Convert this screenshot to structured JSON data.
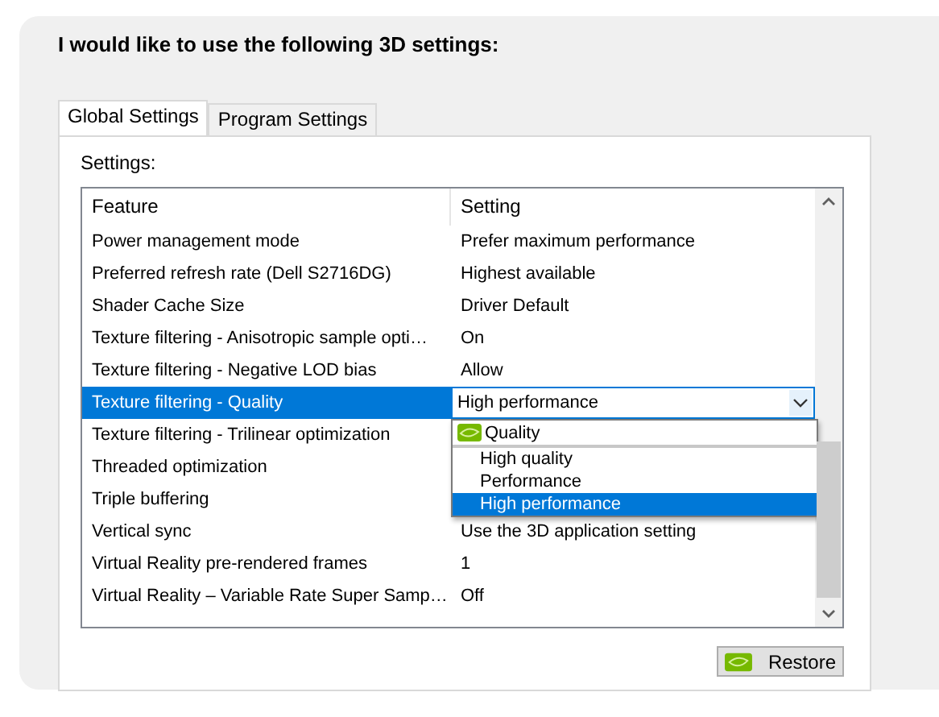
{
  "heading": "I would like to use the following 3D settings:",
  "tabs": [
    {
      "label": "Global Settings",
      "selected": true
    },
    {
      "label": "Program Settings",
      "selected": false
    }
  ],
  "settings_label": "Settings:",
  "table": {
    "columns": [
      "Feature",
      "Setting"
    ],
    "rows": [
      {
        "feature": "Power management mode",
        "setting": "Prefer maximum performance",
        "selected": false
      },
      {
        "feature": "Preferred refresh rate (Dell S2716DG)",
        "setting": "Highest available",
        "selected": false
      },
      {
        "feature": "Shader Cache Size",
        "setting": "Driver Default",
        "selected": false
      },
      {
        "feature": "Texture filtering - Anisotropic sample opti…",
        "setting": "On",
        "selected": false
      },
      {
        "feature": "Texture filtering - Negative LOD bias",
        "setting": "Allow",
        "selected": false
      },
      {
        "feature": "Texture filtering - Quality",
        "setting": "High performance",
        "selected": true
      },
      {
        "feature": "Texture filtering - Trilinear optimization",
        "selected": false
      },
      {
        "feature": "Threaded optimization",
        "selected": false
      },
      {
        "feature": "Triple buffering",
        "selected": false
      },
      {
        "feature": "Vertical sync",
        "setting": "Use the 3D application setting",
        "selected": false
      },
      {
        "feature": "Virtual Reality pre-rendered frames",
        "setting": "1",
        "selected": false
      },
      {
        "feature": "Virtual Reality – Variable Rate Super Samp…",
        "setting": "Off",
        "selected": false
      }
    ]
  },
  "dropdown": {
    "group": "Quality",
    "options": [
      {
        "label": "High quality",
        "selected": false
      },
      {
        "label": "Performance",
        "selected": false
      },
      {
        "label": "High performance",
        "selected": true
      }
    ]
  },
  "restore_button": "Restore"
}
